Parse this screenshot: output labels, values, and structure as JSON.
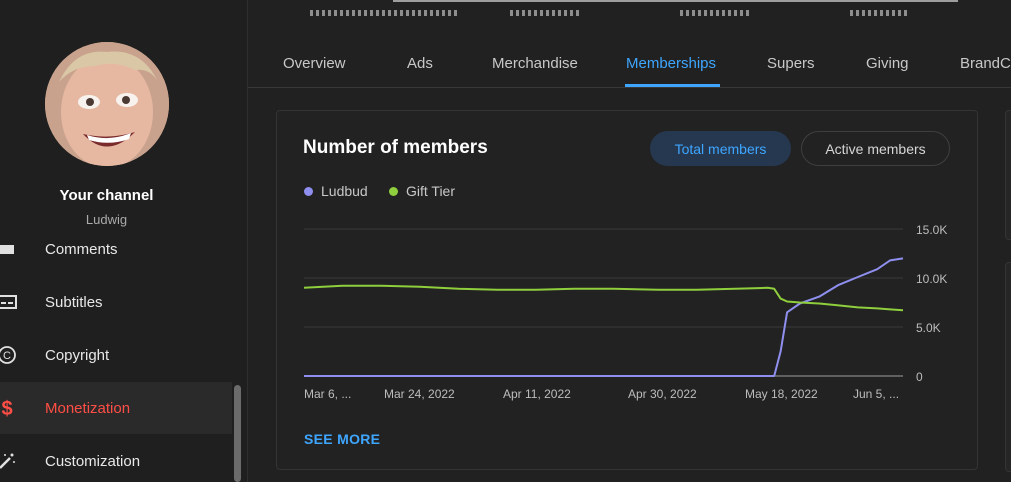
{
  "sidebar": {
    "channel_title": "Your channel",
    "channel_name": "Ludwig",
    "items": [
      {
        "label": "Comments",
        "icon": "comments-icon"
      },
      {
        "label": "Subtitles",
        "icon": "subtitles-icon"
      },
      {
        "label": "Copyright",
        "icon": "copyright-icon"
      },
      {
        "label": "Monetization",
        "icon": "dollar-icon",
        "active": true
      },
      {
        "label": "Customization",
        "icon": "magic-wand-icon"
      }
    ]
  },
  "tabs": [
    {
      "label": "Overview"
    },
    {
      "label": "Ads"
    },
    {
      "label": "Merchandise"
    },
    {
      "label": "Memberships",
      "active": true
    },
    {
      "label": "Supers"
    },
    {
      "label": "Giving"
    },
    {
      "label": "BrandC"
    }
  ],
  "card": {
    "title": "Number of members",
    "toggle": {
      "selected": "Total members",
      "other": "Active members"
    },
    "see_more": "SEE MORE"
  },
  "colors": {
    "accent": "#3ea6ff",
    "active_nav": "#ff4e45",
    "ludbud": "#8f8ff0",
    "gift_tier": "#8fce3c"
  },
  "chart_data": {
    "type": "line",
    "title": "Number of members",
    "x_tick_labels": [
      "Mar 6, ...",
      "Mar 24, 2022",
      "Apr 11, 2022",
      "Apr 30, 2022",
      "May 18, 2022",
      "Jun 5, ..."
    ],
    "y_tick_labels": [
      "15.0K",
      "10.0K",
      "5.0K",
      "0"
    ],
    "ylim": [
      0,
      15000
    ],
    "grid": true,
    "legend_position": "top-left",
    "x_dates": [
      "2022-03-06",
      "2022-03-12",
      "2022-03-18",
      "2022-03-24",
      "2022-03-30",
      "2022-04-05",
      "2022-04-11",
      "2022-04-17",
      "2022-04-23",
      "2022-04-30",
      "2022-05-06",
      "2022-05-12",
      "2022-05-17",
      "2022-05-18",
      "2022-05-19",
      "2022-05-20",
      "2022-05-22",
      "2022-05-25",
      "2022-05-28",
      "2022-05-31",
      "2022-06-03",
      "2022-06-05",
      "2022-06-07"
    ],
    "series": [
      {
        "name": "Ludbud",
        "color": "#8f8ff0",
        "values": [
          0,
          0,
          0,
          0,
          0,
          0,
          0,
          0,
          0,
          0,
          0,
          0,
          0,
          0,
          2500,
          6500,
          7400,
          8100,
          9300,
          10100,
          10900,
          11800,
          12000
        ]
      },
      {
        "name": "Gift Tier",
        "color": "#8fce3c",
        "values": [
          9000,
          9200,
          9200,
          9100,
          8900,
          8800,
          8800,
          8900,
          8900,
          8800,
          8800,
          8900,
          9000,
          8900,
          7900,
          7600,
          7500,
          7400,
          7200,
          7000,
          6900,
          6800,
          6700
        ]
      }
    ]
  }
}
